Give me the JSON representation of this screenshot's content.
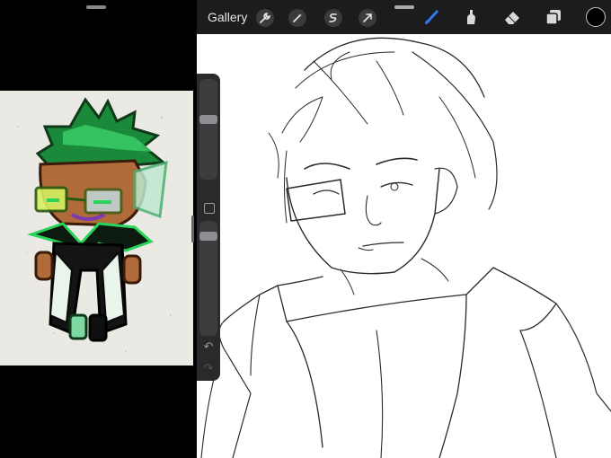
{
  "toolbar": {
    "gallery_label": "Gallery",
    "actions": [
      "wrench-icon",
      "magic-wand-icon",
      "selection-icon",
      "transform-arrow-icon"
    ],
    "tools": [
      "brush-icon",
      "smudge-icon",
      "eraser-icon",
      "layers-icon"
    ],
    "active_tool": "brush-icon",
    "active_color": "#000000",
    "accent_color": "#2f7bf5"
  },
  "sidebar": {
    "brush_size_level": 0.55,
    "opacity_level": 0.5
  },
  "reference": {
    "description_icon": "character-reference-image"
  }
}
